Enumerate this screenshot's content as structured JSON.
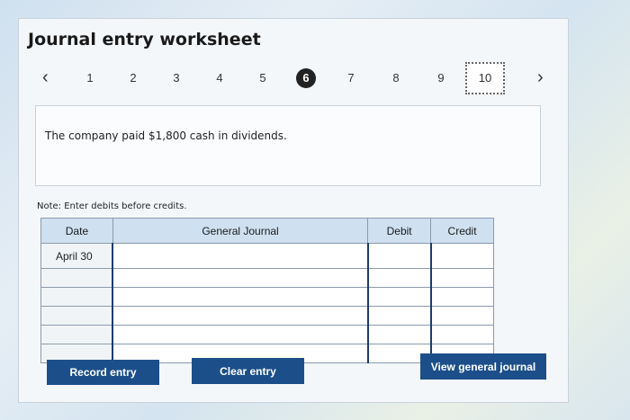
{
  "worksheet": {
    "title": "Journal entry worksheet",
    "prev_icon": "chevron-left-icon",
    "next_icon": "chevron-right-icon",
    "steps": [
      "1",
      "2",
      "3",
      "4",
      "5",
      "6",
      "7",
      "8",
      "9",
      "10"
    ],
    "active_step": "6",
    "prompt": "The company paid $1,800 cash in dividends.",
    "note": "Note: Enter debits before credits."
  },
  "table": {
    "headers": [
      "Date",
      "General Journal",
      "Debit",
      "Credit"
    ],
    "rows": [
      {
        "date": "April 30",
        "account": "",
        "debit": "",
        "credit": ""
      },
      {
        "date": "",
        "account": "",
        "debit": "",
        "credit": ""
      },
      {
        "date": "",
        "account": "",
        "debit": "",
        "credit": ""
      },
      {
        "date": "",
        "account": "",
        "debit": "",
        "credit": ""
      },
      {
        "date": "",
        "account": "",
        "debit": "",
        "credit": ""
      },
      {
        "date": "",
        "account": "",
        "debit": "",
        "credit": ""
      }
    ]
  },
  "buttons": {
    "record": "Record entry",
    "clear": "Clear entry",
    "view": "View general journal"
  }
}
